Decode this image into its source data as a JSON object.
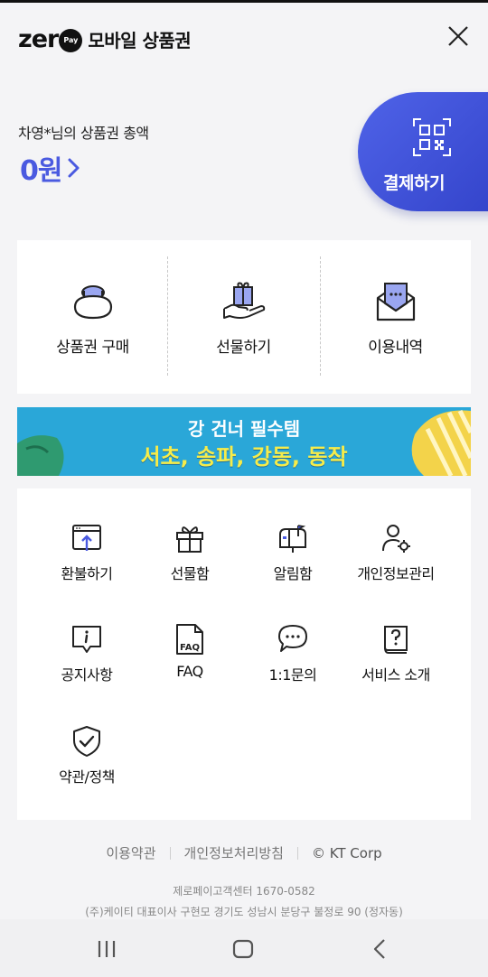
{
  "header": {
    "logo_text": "zer",
    "logo_badge": "Pay",
    "title": "모바일 상품권"
  },
  "balance": {
    "label": "차영*님의 상품권 총액",
    "value": "0원"
  },
  "pay_button": {
    "label": "결제하기"
  },
  "quick_actions": [
    {
      "label": "상품권 구매",
      "icon": "wallet-purse-icon"
    },
    {
      "label": "선물하기",
      "icon": "gift-hand-icon"
    },
    {
      "label": "이용내역",
      "icon": "envelope-history-icon"
    }
  ],
  "banner": {
    "line1": "강 건너 필수템",
    "line2": "서초, 송파, 강동, 동작"
  },
  "menu": [
    {
      "label": "환불하기",
      "icon": "refund-icon"
    },
    {
      "label": "선물함",
      "icon": "gift-box-icon"
    },
    {
      "label": "알림함",
      "icon": "mailbox-icon"
    },
    {
      "label": "개인정보관리",
      "icon": "user-settings-icon"
    },
    {
      "label": "공지사항",
      "icon": "notice-icon"
    },
    {
      "label": "FAQ",
      "icon": "faq-document-icon"
    },
    {
      "label": "1:1문의",
      "icon": "chat-bubble-icon"
    },
    {
      "label": "서비스 소개",
      "icon": "help-book-icon"
    },
    {
      "label": "약관/정책",
      "icon": "shield-check-icon"
    }
  ],
  "footer": {
    "terms": "이용약관",
    "privacy": "개인정보처리방침",
    "copyright": "© KT Corp",
    "cs_center": "제로페이고객센터 1670-0582",
    "address": "(주)케이티 대표이사 구현모 경기도 성남시 분당구 불정로 90 (정자동)"
  },
  "colors": {
    "accent": "#4a5ae0",
    "pay_button": "#3b4bd6",
    "banner_bg": "#2aa7d8",
    "banner_text": "#f6ec4a"
  }
}
